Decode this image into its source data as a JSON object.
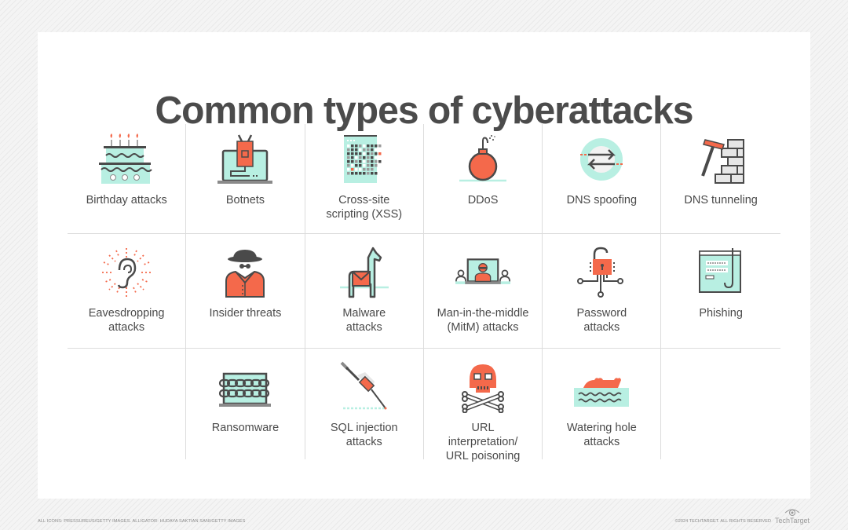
{
  "title": "Common types of cyberattacks",
  "colors": {
    "accent_orange": "#f4694b",
    "accent_mint": "#b8efe2",
    "dark_gray": "#4a4a4a",
    "grid_line": "#dcdcdc"
  },
  "rows": [
    {
      "items": [
        {
          "label": "Birthday attacks",
          "icon": "birthday-cake-icon"
        },
        {
          "label": "Botnets",
          "icon": "botnet-laptop-icon"
        },
        {
          "label": "Cross-site\nscripting (XSS)",
          "icon": "xss-grid-icon"
        },
        {
          "label": "DDoS",
          "icon": "bomb-icon"
        },
        {
          "label": "DNS spoofing",
          "icon": "swap-arrows-icon"
        },
        {
          "label": "DNS tunneling",
          "icon": "hammer-brick-wall-icon"
        }
      ]
    },
    {
      "items": [
        {
          "label": "Eavesdropping\nattacks",
          "icon": "ear-icon"
        },
        {
          "label": "Insider threats",
          "icon": "spy-icon"
        },
        {
          "label": "Malware\nattacks",
          "icon": "trojan-horse-icon"
        },
        {
          "label": "Man-in-the-middle\n(MitM) attacks",
          "icon": "mitm-laptop-icon"
        },
        {
          "label": "Password\nattacks",
          "icon": "padlock-circuit-icon"
        },
        {
          "label": "Phishing",
          "icon": "phishing-hook-icon"
        }
      ]
    },
    {
      "items": [
        {
          "label": "Ransomware",
          "icon": "chained-laptop-icon"
        },
        {
          "label": "SQL injection\nattacks",
          "icon": "syringe-icon"
        },
        {
          "label": "URL\ninterpretation/\nURL poisoning",
          "icon": "skull-crossbones-icon"
        },
        {
          "label": "Watering hole\nattacks",
          "icon": "alligator-water-icon"
        }
      ]
    }
  ],
  "footer": {
    "credits": "ALL ICONS: PRESSUREUS/GETTY IMAGES. ALLIGATOR: HUDAYA SAKTIAN SANI/GETTY IMAGES",
    "copyright": "©2024 TECHTARGET. ALL RIGHTS RESERVED",
    "brand": "TechTarget"
  }
}
